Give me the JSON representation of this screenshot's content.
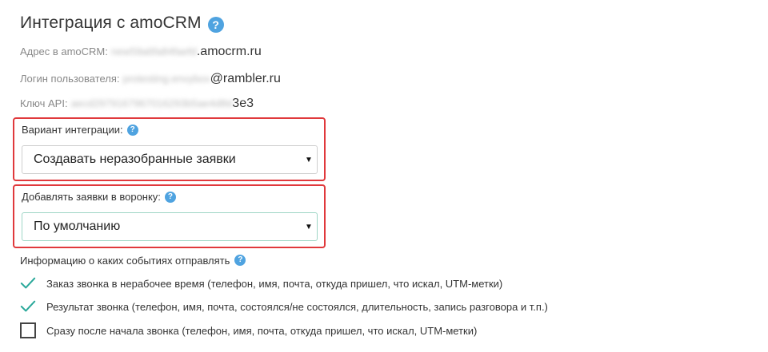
{
  "header": {
    "title": "Интеграция с amoCRM",
    "help_icon": "question-circle-icon"
  },
  "info": {
    "address": {
      "label": "Адрес в amoCRM:",
      "blurred": "new59a6fa84faefd",
      "value": ".amocrm.ru"
    },
    "login": {
      "label": "Логин пользователя:",
      "blurred": "protesting.envybox",
      "value": "@rambler.ru"
    },
    "api_key": {
      "label": "Ключ API:",
      "blurred": "aecd2979167967016293b5ae4d8d",
      "value": "3e3"
    }
  },
  "integration": {
    "label": "Вариант интеграции:",
    "selected": "Создавать неразобранные заявки"
  },
  "pipeline": {
    "label": "Добавлять заявки в воронку:",
    "selected": "По умолчанию"
  },
  "events": {
    "title": "Информацию о каких событиях отправлять",
    "items": [
      {
        "label": "Заказ звонка в нерабочее время (телефон, имя, почта, откуда пришел, что искал, UTM-метки)",
        "checked": true
      },
      {
        "label": "Результат звонка (телефон, имя, почта, состоялся/не состоялся, длительность, запись разговора и т.п.)",
        "checked": true
      },
      {
        "label": "Сразу после начала звонка (телефон, имя, почта, откуда пришел, что искал, UTM-метки)",
        "checked": false
      }
    ]
  },
  "colors": {
    "highlight_border": "#e0393c",
    "help_icon": "#4fa3e0",
    "check_mark": "#2aa89a"
  }
}
